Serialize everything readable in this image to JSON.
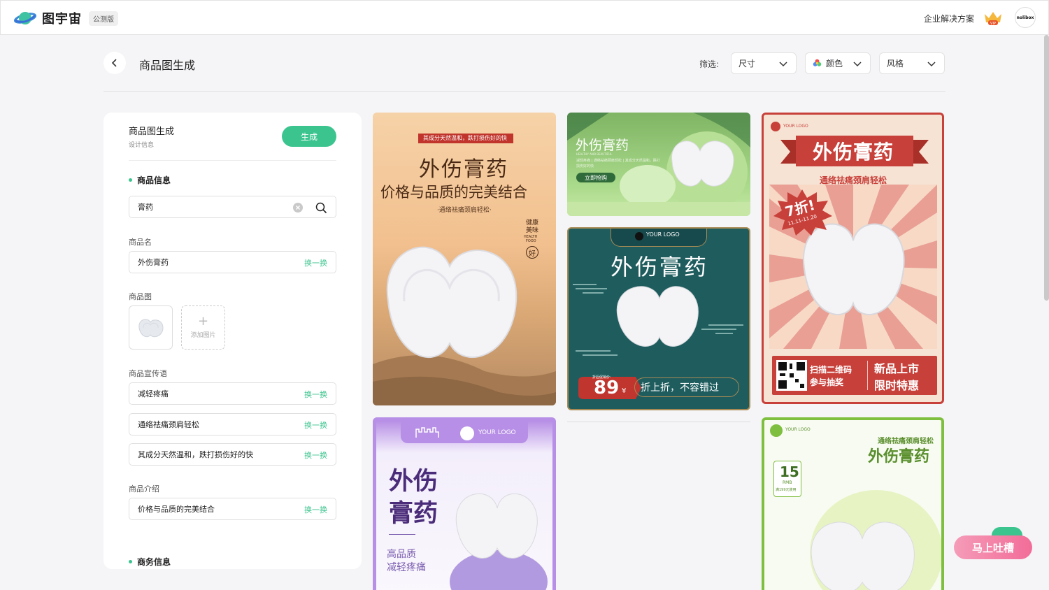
{
  "app": {
    "name": "图宇宙",
    "badge": "公测版"
  },
  "topbar": {
    "enterprise_link": "企业解决方案",
    "vip_label": "VIP",
    "avatar_text": "nolibox"
  },
  "header": {
    "title": "商品图生成",
    "filter_label": "筛选:",
    "filters": {
      "size": "尺寸",
      "color": "颜色",
      "style": "风格"
    }
  },
  "panel": {
    "title": "商品图生成",
    "subtitle": "设计信息",
    "generate_button": "生成",
    "section_product": "商品信息",
    "search_value": "膏药",
    "product_name_label": "商品名",
    "product_name_value": "外伤膏药",
    "swap_label": "换一换",
    "product_image_label": "商品图",
    "add_image_label": "添加图片",
    "slogan_label": "商品宣传语",
    "slogans": [
      "减轻疼痛",
      "通络祛痛颈肩轻松",
      "其成分天然温和，跌打损伤好的快"
    ],
    "intro_label": "商品介绍",
    "intro_value": "价格与品质的完美结合",
    "section_business": "商务信息"
  },
  "cards": {
    "c1": {
      "banner": "其成分天然温和，跌打损伤好的快",
      "title": "外伤膏药",
      "subtitle": "价格与品质的完美结合",
      "tagline": "·通络祛痛颈肩轻松·",
      "stamp_1": "健康",
      "stamp_2": "美味",
      "stamp_3": "HEALTH",
      "stamp_4": "FOOD",
      "stamp_seal": "好"
    },
    "c2": {
      "title": "外伤膏药",
      "small_en": "HEALTHY AND BEAUTIFUL",
      "desc": "减轻疼痛 | 通络祛痛颈肩轻松 | 其成分天然温和，跌打损伤好的快",
      "button": "立即抢购"
    },
    "c3": {
      "logo": "YOUR LOGO",
      "title": "外伤膏药",
      "price_tag": "折后促销价:",
      "price": "89",
      "currency": "¥",
      "slogan": "折上折，不容错过"
    },
    "c4": {
      "logo": "YOUR LOGO",
      "title": "外伤膏药",
      "subtitle": "通络祛痛颈肩轻松",
      "discount": "7折!",
      "dates": "11.11-11.20",
      "qr_line1": "扫描二维码",
      "qr_line2": "参与抽奖",
      "promo_line1": "新品上市",
      "promo_line2": "限时特惠"
    },
    "c5": {
      "logo": "YOUR LOGO",
      "title_1": "外伤",
      "title_2": "膏药",
      "sub_1": "高品质",
      "sub_2": "减轻疼痛"
    },
    "c6": {
      "logo": "YOUR LOGO",
      "subtitle": "通络祛痛颈肩轻松",
      "title": "外伤膏药",
      "coupon_value": "15",
      "coupon_unit": "RMB",
      "coupon_note": "满199元使用"
    }
  },
  "feedback_button": "马上吐槽",
  "colors": {
    "accent": "#3cc48f",
    "card_green": "#a9d98a",
    "card_teal": "#1e5c5e",
    "card_red": "#c8403a",
    "card_purple": "#b78fe6",
    "card_lime": "#7fbf3f"
  }
}
